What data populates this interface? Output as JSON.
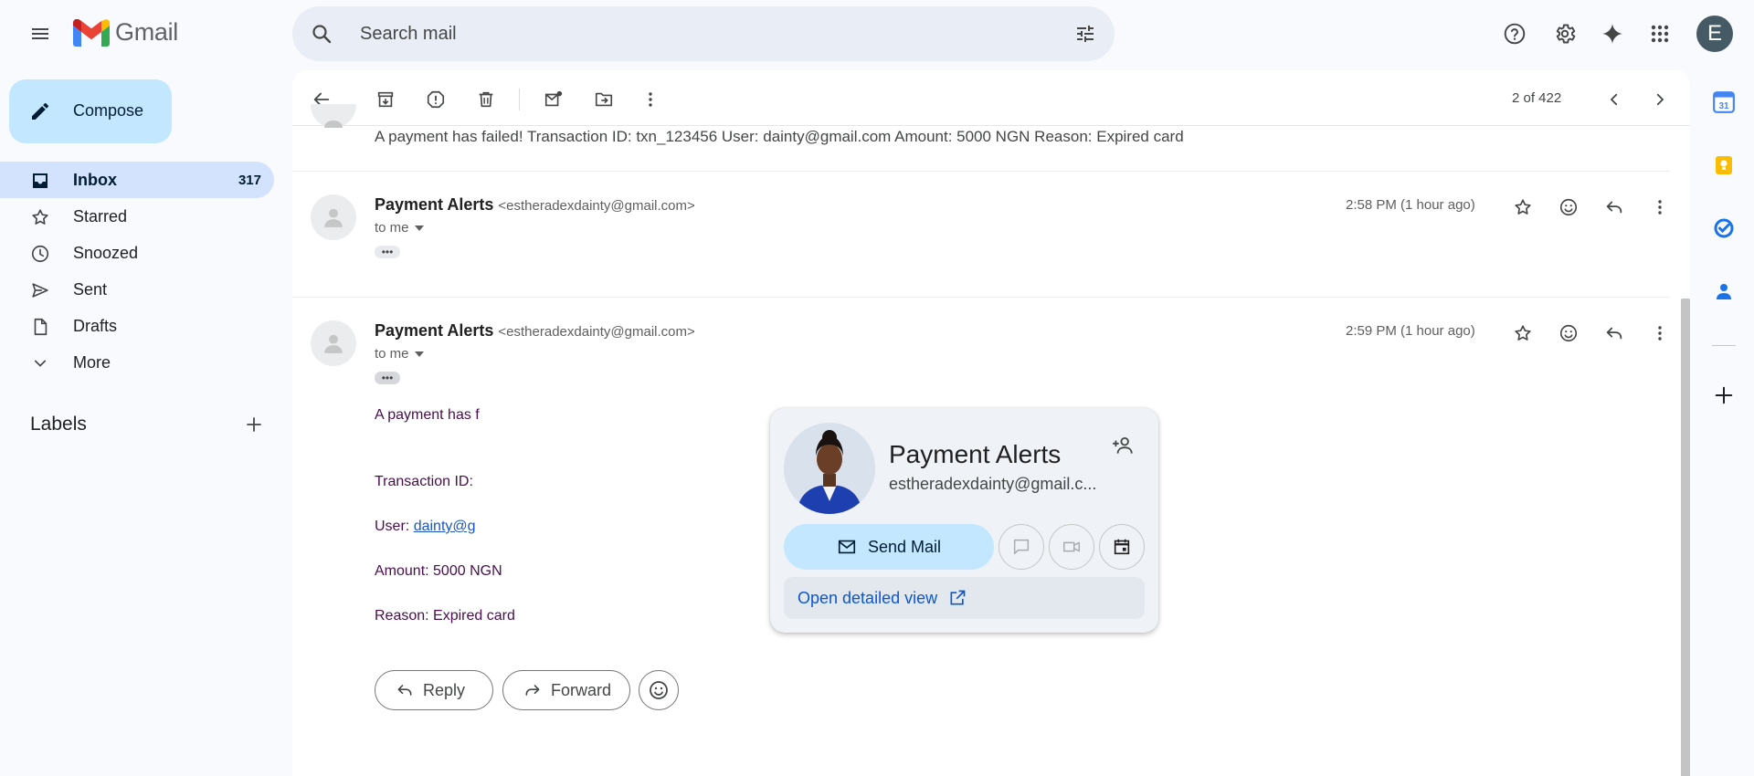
{
  "app": {
    "name": "Gmail",
    "account_initial": "E"
  },
  "search": {
    "placeholder": "Search mail"
  },
  "compose": {
    "label": "Compose"
  },
  "nav": {
    "items": [
      {
        "label": "Inbox",
        "count": "317",
        "icon": "inbox-icon"
      },
      {
        "label": "Starred",
        "count": "",
        "icon": "star-icon"
      },
      {
        "label": "Snoozed",
        "count": "",
        "icon": "clock-icon"
      },
      {
        "label": "Sent",
        "count": "",
        "icon": "send-icon"
      },
      {
        "label": "Drafts",
        "count": "",
        "icon": "draft-icon"
      },
      {
        "label": "More",
        "count": "",
        "icon": "chevron-down-icon"
      }
    ]
  },
  "labels": {
    "heading": "Labels"
  },
  "toolbar": {
    "pager": "2 of 422"
  },
  "thread": {
    "collapsed_snippet": "A payment has failed! Transaction ID: txn_123456 User: dainty@gmail.com Amount: 5000 NGN Reason: Expired card",
    "messages": [
      {
        "sender_name": "Payment Alerts",
        "sender_email": "<estheradexdainty@gmail.com>",
        "to": "to me",
        "time": "2:58 PM (1 hour ago)"
      },
      {
        "sender_name": "Payment Alerts",
        "sender_email": "<estheradexdainty@gmail.com>",
        "to": "to me",
        "time": "2:59 PM (1 hour ago)",
        "body": {
          "line1": "A payment has f",
          "txn_label": "Transaction ID:",
          "user_label": "User:",
          "user_link": "dainty@g",
          "amount": "Amount: 5000 NGN",
          "reason": "Reason: Expired card"
        }
      }
    ]
  },
  "actions": {
    "reply": "Reply",
    "forward": "Forward"
  },
  "hover_card": {
    "name": "Payment Alerts",
    "email": "estheradexdainty@gmail.c...",
    "send_mail": "Send Mail",
    "detailed_view": "Open detailed view"
  },
  "colors": {
    "accent": "#c2e7ff",
    "nav_active": "#d3e3fd",
    "link": "#0b57d0",
    "body_text": "#4a0e4e"
  }
}
